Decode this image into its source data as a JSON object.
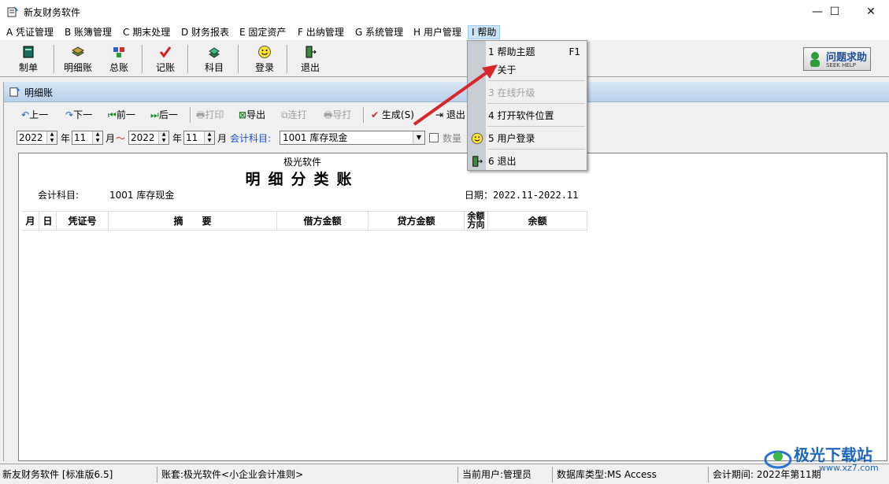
{
  "window": {
    "title": "新友财务软件",
    "minimize": "—",
    "maximize": "☐",
    "close": "✕"
  },
  "menubar": [
    {
      "label": "A 凭证管理"
    },
    {
      "label": "B 账簿管理"
    },
    {
      "label": "C 期末处理"
    },
    {
      "label": "D 财务报表"
    },
    {
      "label": "E 固定资产"
    },
    {
      "label": "F 出纳管理"
    },
    {
      "label": "G 系统管理"
    },
    {
      "label": "H 用户管理"
    },
    {
      "label": "I 帮助"
    }
  ],
  "toolbar": {
    "make": "制单",
    "detail": "明细账",
    "general": "总账",
    "post": "记账",
    "subject": "科目",
    "login": "登录",
    "exit": "退出",
    "help_logo_main": "问题求助",
    "help_logo_sub": "SEEK HELP"
  },
  "child": {
    "title": "明细账",
    "buttons": {
      "prev": "上一",
      "next": "下一",
      "first": "前一",
      "last": "后一",
      "print": "打印",
      "export": "导出",
      "cont_print": "连打",
      "batch_print": "导打",
      "generate": "生成(S)",
      "exit": "退出"
    },
    "filter": {
      "year_from": "2022",
      "year_label": "年",
      "month_from": "11",
      "month_label": "月",
      "tilde": "～",
      "year_to": "2022",
      "month_to": "11",
      "account_label": "会计科目:",
      "account_value": "1001  库存现金",
      "qty_label": "数量"
    }
  },
  "report": {
    "company": "极光软件",
    "title": "明细分类账",
    "account_label": "会计科目:",
    "account_value": "1001  库存现金",
    "date": "日期：2022.11-2022.11",
    "columns": [
      "月",
      "日",
      "凭证号",
      "摘　　要",
      "借方金额",
      "贷方金额",
      "余额方向",
      "余额"
    ]
  },
  "help_menu": {
    "items": [
      {
        "label": "1 帮助主题",
        "shortcut": "F1",
        "enabled": true
      },
      {
        "label": "2 关于",
        "shortcut": "",
        "enabled": true
      },
      {
        "label": "3 在线升级",
        "shortcut": "",
        "enabled": false
      },
      {
        "label": "4 打开软件位置",
        "shortcut": "",
        "enabled": true
      },
      {
        "label": "5 用户登录",
        "shortcut": "",
        "enabled": true
      },
      {
        "label": "6 退出",
        "shortcut": "",
        "enabled": true
      }
    ]
  },
  "statusbar": {
    "app": "新友财务软件 [标准版6.5]",
    "book": "账套:极光软件<小企业会计准则>",
    "user": "当前用户:管理员",
    "db": "数据库类型:MS Access",
    "period": "会计期间: 2022年第11期"
  },
  "watermark": {
    "text": "极光下载站",
    "url": "www.xz7.com"
  },
  "colors": {
    "accent_arrow": "#d9262c",
    "child_title": "#c6d9ef",
    "menu_highlight": "#cce4f7"
  }
}
